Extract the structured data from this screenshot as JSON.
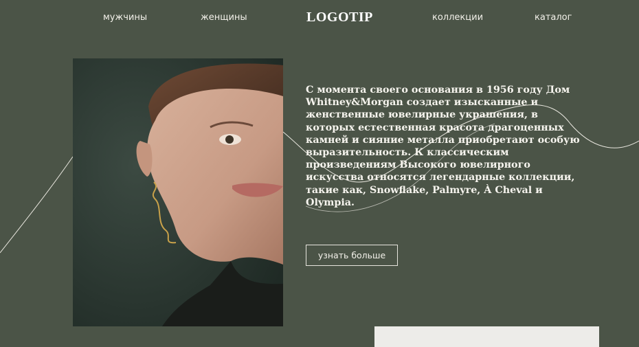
{
  "nav": {
    "men": "мужчины",
    "women": "женщины",
    "logo": "LOGOTIP",
    "collections": "коллекции",
    "catalog": "каталог"
  },
  "hero": {
    "text": "С момента своего основания в 1956 году Дом Whitney&Morgan создает изысканные и женственные ювелирные украшения, в которых естественная красота драгоценных камней и сияние металла приобретают особую выразительность. К классическим произведениям Высокого ювелирного искусства относятся легендарные коллекции, такие как, Snowflake, Palmyre, À Cheval и Olympia.",
    "button_label": "узнать больше"
  },
  "colors": {
    "background": "#4b5447",
    "text": "#f3f1ea",
    "earring_gold": "#c9a24a"
  }
}
